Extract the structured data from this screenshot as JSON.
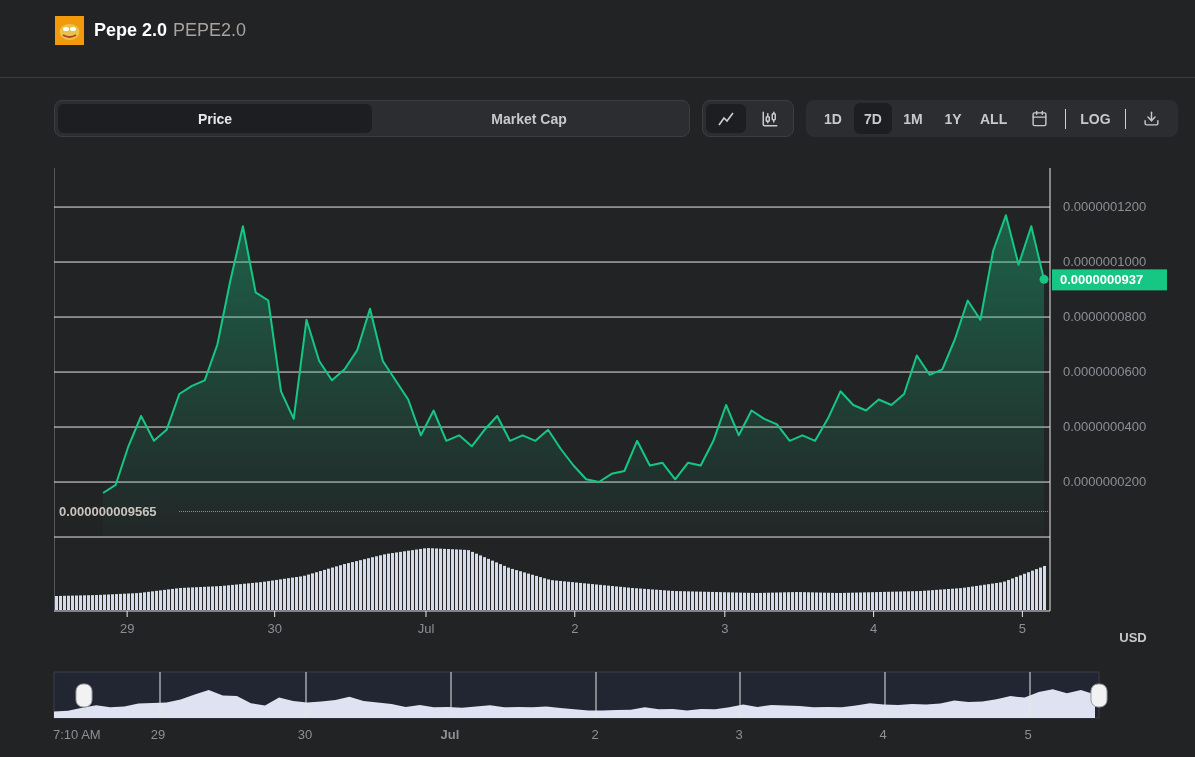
{
  "coin": {
    "name": "Pepe 2.0",
    "symbol": "PEPE2.0"
  },
  "metric_tabs": [
    {
      "label": "Price",
      "selected": true
    },
    {
      "label": "Market Cap",
      "selected": false
    }
  ],
  "chart_types": [
    {
      "kind": "line",
      "selected": true
    },
    {
      "kind": "candles",
      "selected": false
    }
  ],
  "ranges": [
    {
      "label": "1D",
      "selected": false
    },
    {
      "label": "7D",
      "selected": true
    },
    {
      "label": "1M",
      "selected": false
    },
    {
      "label": "1Y",
      "selected": false
    },
    {
      "label": "ALL",
      "selected": false
    }
  ],
  "log_label": "LOG",
  "price_chart": {
    "current_price": "0.0000000937",
    "currency": "USD",
    "min_price_label": "0.000000009565",
    "date_labels": [
      "29",
      "30",
      "Jul",
      "2",
      "3",
      "4",
      "5"
    ],
    "chart_data": {
      "type": "area",
      "ylim": [
        -2.69e-08,
        1.342e-07
      ],
      "grid": true,
      "yticks": [
        {
          "value": 2e-08,
          "label": "0.0000000200"
        },
        {
          "value": 4e-08,
          "label": "0.0000000400"
        },
        {
          "value": 6e-08,
          "label": "0.0000000600"
        },
        {
          "value": 8e-08,
          "label": "0.0000000800"
        },
        {
          "value": 1e-07,
          "label": "0.0000001000"
        },
        {
          "value": 1.2e-07,
          "label": "0.0000001200"
        }
      ],
      "series": [
        {
          "color": "#16c784",
          "values": [
            1.6e-08,
            1.9e-08,
            3.3e-08,
            4.4e-08,
            3.5e-08,
            3.9e-08,
            5.2e-08,
            5.5e-08,
            5.7e-08,
            7e-08,
            9.3e-08,
            1.13e-07,
            8.9e-08,
            8.6e-08,
            5.3e-08,
            4.3e-08,
            7.9e-08,
            6.4e-08,
            5.7e-08,
            6.1e-08,
            6.8e-08,
            8.3e-08,
            6.4e-08,
            5.7e-08,
            5e-08,
            3.7e-08,
            4.6e-08,
            3.5e-08,
            3.7e-08,
            3.3e-08,
            3.9e-08,
            4.4e-08,
            3.5e-08,
            3.7e-08,
            3.5e-08,
            3.9e-08,
            3.2e-08,
            2.6e-08,
            2.1e-08,
            2e-08,
            2.3e-08,
            2.4e-08,
            3.5e-08,
            2.6e-08,
            2.7e-08,
            2.1e-08,
            2.7e-08,
            2.6e-08,
            3.5e-08,
            4.8e-08,
            3.7e-08,
            4.6e-08,
            4.3e-08,
            4.1e-08,
            3.5e-08,
            3.7e-08,
            3.5e-08,
            4.3e-08,
            5.3e-08,
            4.8e-08,
            4.6e-08,
            5e-08,
            4.8e-08,
            5.2e-08,
            6.6e-08,
            5.9e-08,
            6.1e-08,
            7.2e-08,
            8.6e-08,
            7.9e-08,
            1.04e-07,
            1.17e-07,
            9.9e-08,
            1.13e-07,
            9.37e-08
          ]
        }
      ]
    }
  },
  "navigator": {
    "labels": [
      {
        "text": "7:10 AM",
        "bold": false
      },
      {
        "text": "29",
        "bold": false
      },
      {
        "text": "30",
        "bold": false
      },
      {
        "text": "Jul",
        "bold": true
      },
      {
        "text": "2",
        "bold": false
      },
      {
        "text": "3",
        "bold": false
      },
      {
        "text": "4",
        "bold": false
      },
      {
        "text": "5",
        "bold": false
      }
    ]
  }
}
